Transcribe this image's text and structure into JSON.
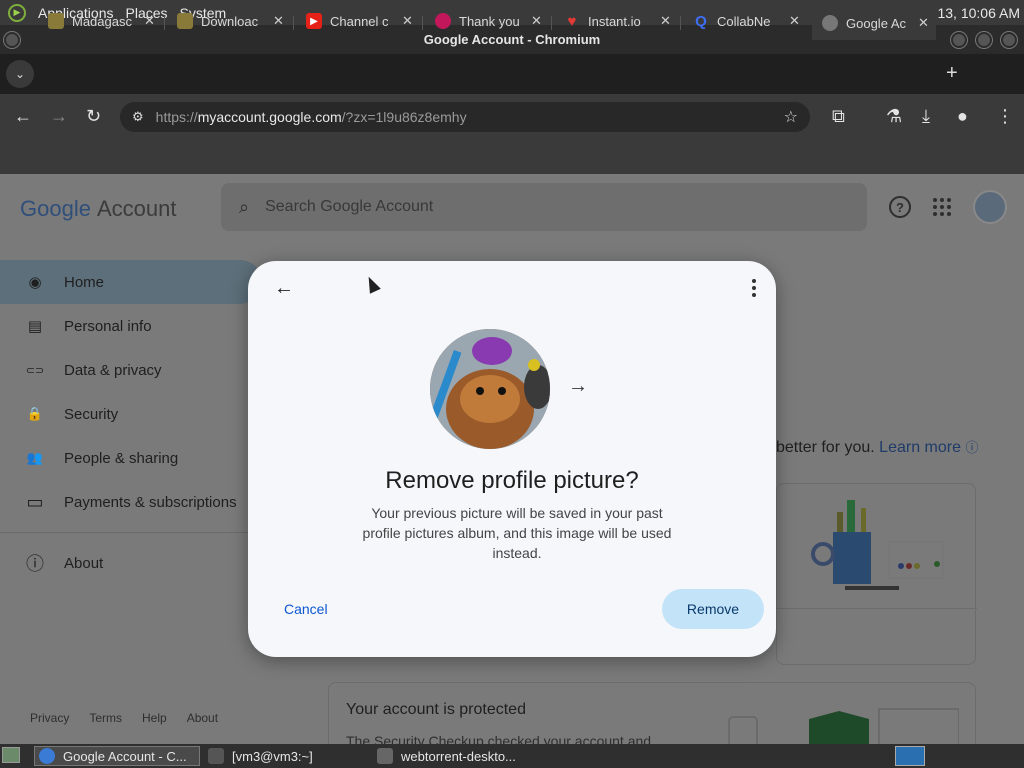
{
  "top_panel": {
    "menus": [
      "Applications",
      "Places",
      "System"
    ],
    "lang": "en",
    "datetime": "Fri Dec 13, 10:06 AM"
  },
  "window": {
    "title": "Google Account - Chromium"
  },
  "tabs": [
    {
      "title": "Madagasc",
      "fav_color": "#8a7a3a"
    },
    {
      "title": "Downloac",
      "fav_color": "#8a7a3a"
    },
    {
      "title": "Channel c",
      "fav_color": "#e62117"
    },
    {
      "title": "Thank you",
      "fav_color": "#c2185b"
    },
    {
      "title": "Instant.io",
      "fav_color": "#e53935"
    },
    {
      "title": "CollabNe",
      "fav_color": "#3d6ef5"
    },
    {
      "title": "Google Ac",
      "fav_color": "#777777"
    }
  ],
  "omnibox": {
    "scheme": "https://",
    "host": "myaccount.google.com",
    "rest": "/?zx=1l9u86z8emhy"
  },
  "header": {
    "logo_google": "Google",
    "logo_account": "Account",
    "search_placeholder": "Search Google Account"
  },
  "nav": {
    "items": [
      {
        "label": "Home",
        "icon": "person-circle-icon",
        "glyph": "◉"
      },
      {
        "label": "Personal info",
        "icon": "id-card-icon",
        "glyph": "▤"
      },
      {
        "label": "Data & privacy",
        "icon": "toggle-icon",
        "glyph": "⊂⊃"
      },
      {
        "label": "Security",
        "icon": "lock-icon",
        "glyph": "🔒"
      },
      {
        "label": "People & sharing",
        "icon": "people-icon",
        "glyph": "👥"
      },
      {
        "label": "Payments & subscriptions",
        "icon": "credit-card-icon",
        "glyph": "▭"
      }
    ],
    "about": {
      "label": "About",
      "icon": "info-icon",
      "glyph": "ⓘ"
    }
  },
  "footer": {
    "links": [
      "Privacy",
      "Terms",
      "Help",
      "About"
    ]
  },
  "background": {
    "tagline": "better for you.",
    "learn_more": "Learn more",
    "card2_title": "Your account is protected",
    "card2_text": "The Security Checkup checked your account and"
  },
  "dialog": {
    "heading": "Remove profile picture?",
    "description": "Your previous picture will be saved in your past profile pictures album, and this image will be used instead.",
    "cancel_label": "Cancel",
    "remove_label": "Remove"
  },
  "taskbar": {
    "items": [
      {
        "label": "Google Account - C..."
      },
      {
        "label": "[vm3@vm3:~]"
      },
      {
        "label": "webtorrent-deskto..."
      }
    ]
  },
  "colors": {
    "accent_blue": "#0b57d0",
    "remove_button": "#c2e3f8",
    "nav_active": "#5d6f7a"
  }
}
